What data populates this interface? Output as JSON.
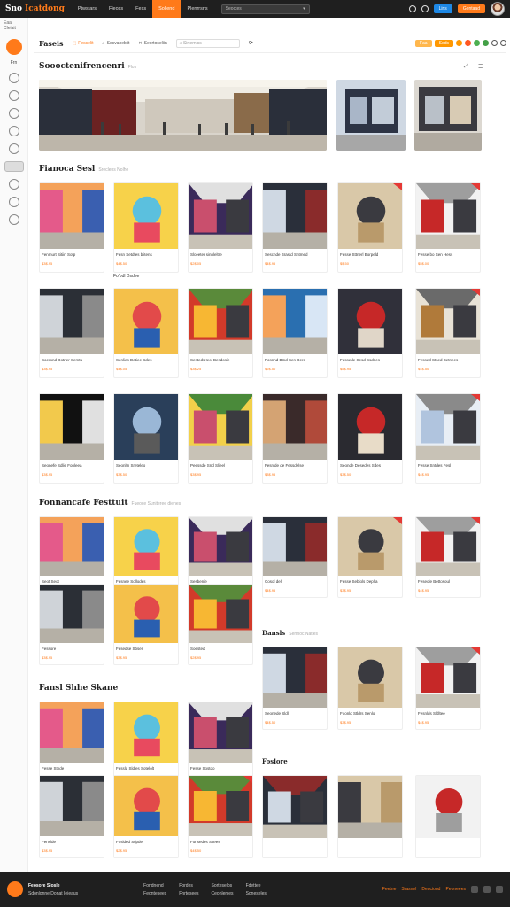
{
  "topbar": {
    "brand_a": "Sno",
    "brand_b": "Icatdong",
    "nav": [
      {
        "label": "Ptwstars",
        "active": false
      },
      {
        "label": "Fleoss",
        "active": false
      },
      {
        "label": "Fess",
        "active": false
      },
      {
        "label": "Sollend",
        "active": true
      },
      {
        "label": "Plenrrsns",
        "active": false
      }
    ],
    "search_placeholder": "Seoctes",
    "btn_blue": "Lins",
    "btn_orange": "Gentaad"
  },
  "rail": {
    "top_text": "Eaa Cleiait",
    "side_text": "Frn"
  },
  "subbar": {
    "title": "Faseis",
    "subtitle": "Floosie",
    "filters": [
      "Fesselit",
      "Sesvaneblit",
      "Seortoseliin"
    ],
    "search_placeholder": "Sirterniss",
    "pill1": "Faa",
    "pill2": "Seds"
  },
  "sections": {
    "s1": {
      "title": "Soooctenifrencenri",
      "sub": "Flos"
    },
    "s2": {
      "title": "Fianoca Sesl",
      "sub": "Sreclens Nolhe"
    },
    "s3": {
      "title": "Fonnancafe Festtuit",
      "sub": "Fueoce Suniteree dienes"
    },
    "s4": {
      "title": "Dansls",
      "sub": "Sermoc Naties"
    },
    "s5": {
      "title": "Fansl Shhe Skane",
      "sub": ""
    },
    "s6": {
      "title": "Foslore",
      "sub": ""
    }
  },
  "grid1": [
    {
      "cap": "Fenmurt Sitiin Sotp",
      "price": "$3$.95"
    },
    {
      "cap": "Fesn Setdtes blitens",
      "price": "$4$.50"
    },
    {
      "cap": "Slceeter sinnleltre",
      "price": "$2$.05"
    },
    {
      "cap": "Sescnde Brastd Sntmed",
      "price": "$4$.95"
    },
    {
      "cap": "Fesse Sttnerl Borpeld",
      "price": "$$.50"
    },
    {
      "cap": "Fesse bo Sen Hess",
      "price": "$5$.00"
    },
    {
      "cap": "Soerond Dotrier Semtu",
      "price": "$3$.95"
    },
    {
      "cap": "Senlies Detiee Sdes",
      "price": "$4$.05"
    },
    {
      "cap": "Sesteds Ieol Besdosie",
      "price": "$3$.25"
    },
    {
      "cap": "Posnnd Btnd Sen Dere",
      "price": "$2$.50"
    },
    {
      "cap": "Fessede Sesd Ssdnes",
      "price": "$5$.95"
    },
    {
      "cap": "Fessed Stsed Betnees",
      "price": "$4$.50"
    },
    {
      "cap": "Seonefe Sdlie Fonleea",
      "price": "$3$.95"
    },
    {
      "cap": "Seonltn Sreteleo",
      "price": "$3$.50"
    },
    {
      "cap": "Peessde Snd Slieel",
      "price": "$3$.95"
    },
    {
      "cap": "Fesnlde de Fessdelse",
      "price": "$3$.95"
    },
    {
      "cap": "Seonde Desedes Sdes",
      "price": "$3$.50"
    },
    {
      "cap": "Fesse Sntdes Fesl",
      "price": "$4$.95"
    }
  ],
  "grid1_extra": "Fo'odl Dsdee",
  "grid2": [
    {
      "cap": "Seot Seot",
      "price": "$3$.50"
    },
    {
      "cap": "Fesnee Sollodes",
      "price": "$4$.00"
    },
    {
      "cap": "Sesbenie",
      "price": "$3$.50"
    },
    {
      "cap": "Cosol delt",
      "price": "$4$.95"
    },
    {
      "cap": "Fesse Sebiols Deplta",
      "price": "$3$.95"
    },
    {
      "cap": "Feseole Bettosoul",
      "price": "$4$.95"
    },
    {
      "cap": "Fessore",
      "price": "$3$.95"
    },
    {
      "cap": "Fesedse Sbsen",
      "price": "$3$.95"
    },
    {
      "cap": "Soested",
      "price": "$2$.95"
    }
  ],
  "grid3": [
    {
      "cap": "Fesse Stnde",
      "price": "$4$.95"
    },
    {
      "cap": "Fessld Sldies Sotelolt",
      "price": "$3$.50"
    },
    {
      "cap": "Fesse Sostdo",
      "price": "$3$.95"
    },
    {
      "cap": "Seonede Sldl",
      "price": "$4$.50"
    },
    {
      "cap": "Foonld Stldrs Senlo",
      "price": "$3$.95"
    },
    {
      "cap": "Fesnlds Sldltee",
      "price": "$4$.95"
    },
    {
      "cap": "Fenslde",
      "price": "$3$.95"
    },
    {
      "cap": "Foslded Stlpde",
      "price": "$2$.95"
    },
    {
      "cap": "Fonsedes Sltees",
      "price": "$4$.50"
    }
  ],
  "footer": {
    "title": "Feosore Slosle",
    "sub": "Sdonlonne Donat Ieieaus",
    "links1": [
      "Fondnend",
      "Feontesees"
    ],
    "links2": [
      "Fordes",
      "Fnrtesees"
    ],
    "links3": [
      "Sorteselos",
      "Ceonlenles"
    ],
    "links4": [
      "Fdettee",
      "Soneseles"
    ],
    "right": [
      "Feetne",
      "Srasnel",
      "Deuciond",
      "Peoneees"
    ]
  },
  "colors": {
    "accent": "#ff7a1a",
    "topbar": "#1f1f1f",
    "blue": "#1e88e5"
  }
}
